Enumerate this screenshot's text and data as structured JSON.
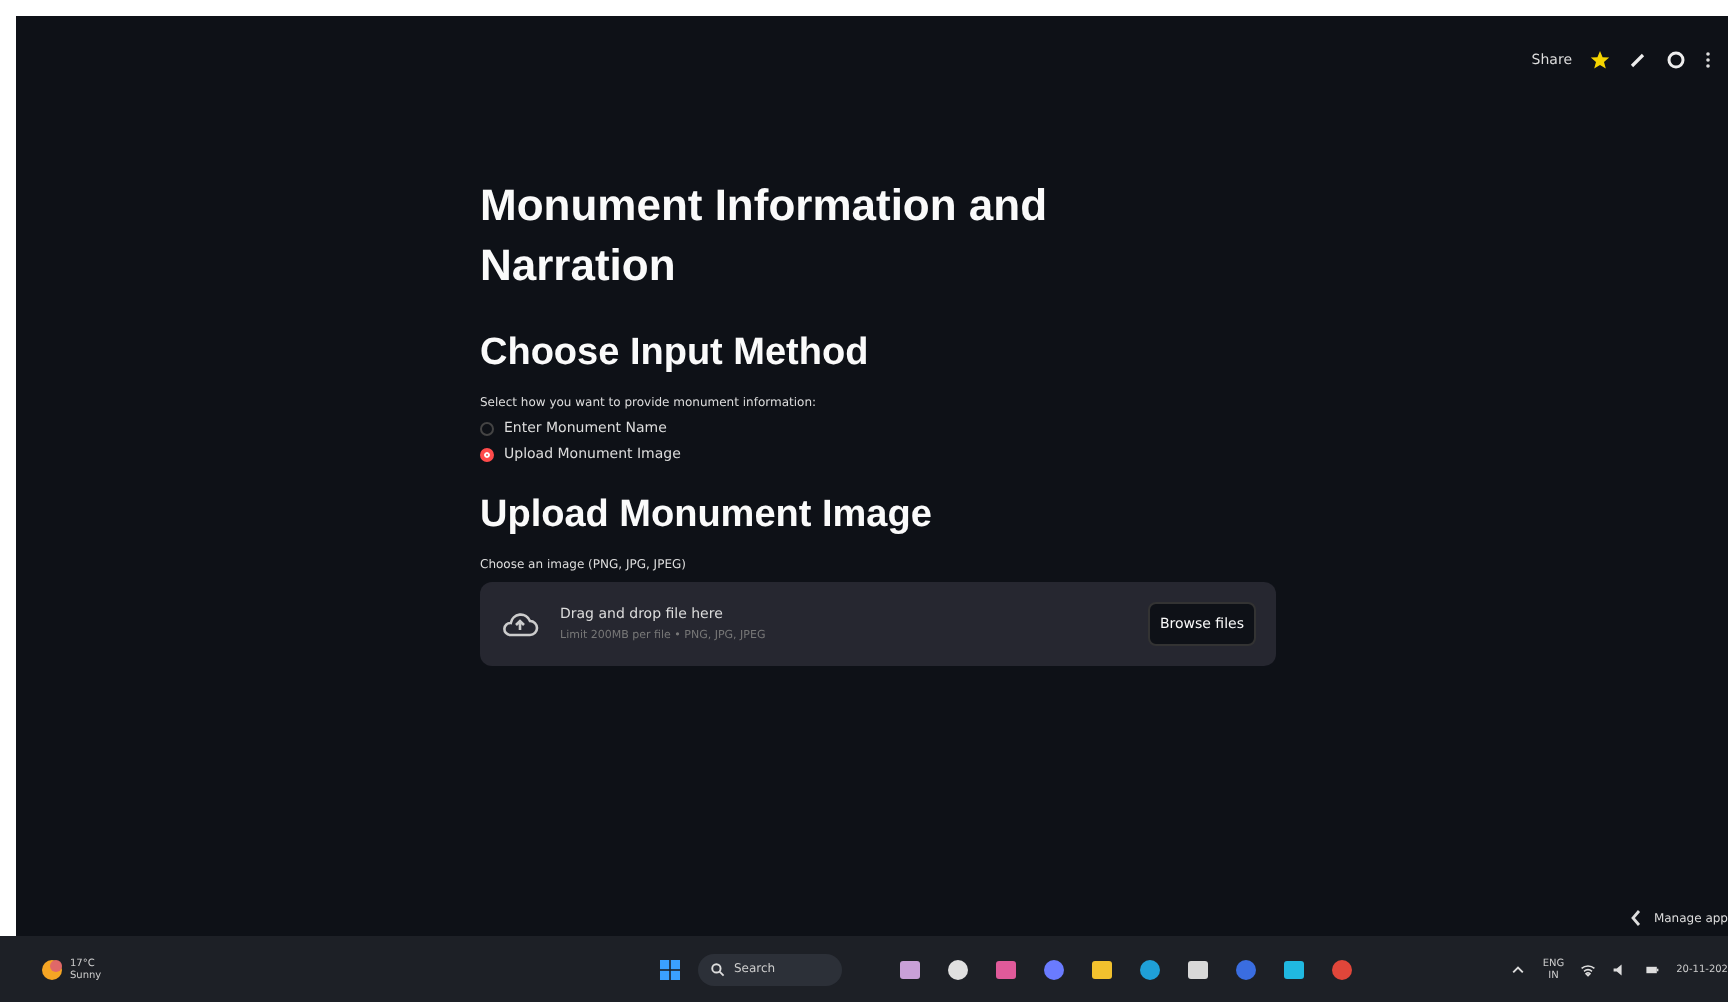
{
  "toolbar": {
    "share": "Share",
    "starred": true
  },
  "title": "Monument Information and Narration",
  "input_method": {
    "heading": "Choose Input Method",
    "label": "Select how you want to provide monument information:",
    "options": [
      {
        "label": "Enter Monument Name",
        "selected": false
      },
      {
        "label": "Upload Monument Image",
        "selected": true
      }
    ]
  },
  "upload": {
    "heading": "Upload Monument Image",
    "label": "Choose an image (PNG, JPG, JPEG)",
    "drop_text": "Drag and drop file here",
    "limit": "Limit 200MB per file • PNG, JPG, JPEG",
    "button": "Browse files"
  },
  "manage_app": "Manage app",
  "taskbar": {
    "weather_temp": "17°C",
    "weather_text": "Sunny",
    "search": "Search",
    "language": "ENG",
    "region": "IN",
    "date": "20-11-202"
  }
}
